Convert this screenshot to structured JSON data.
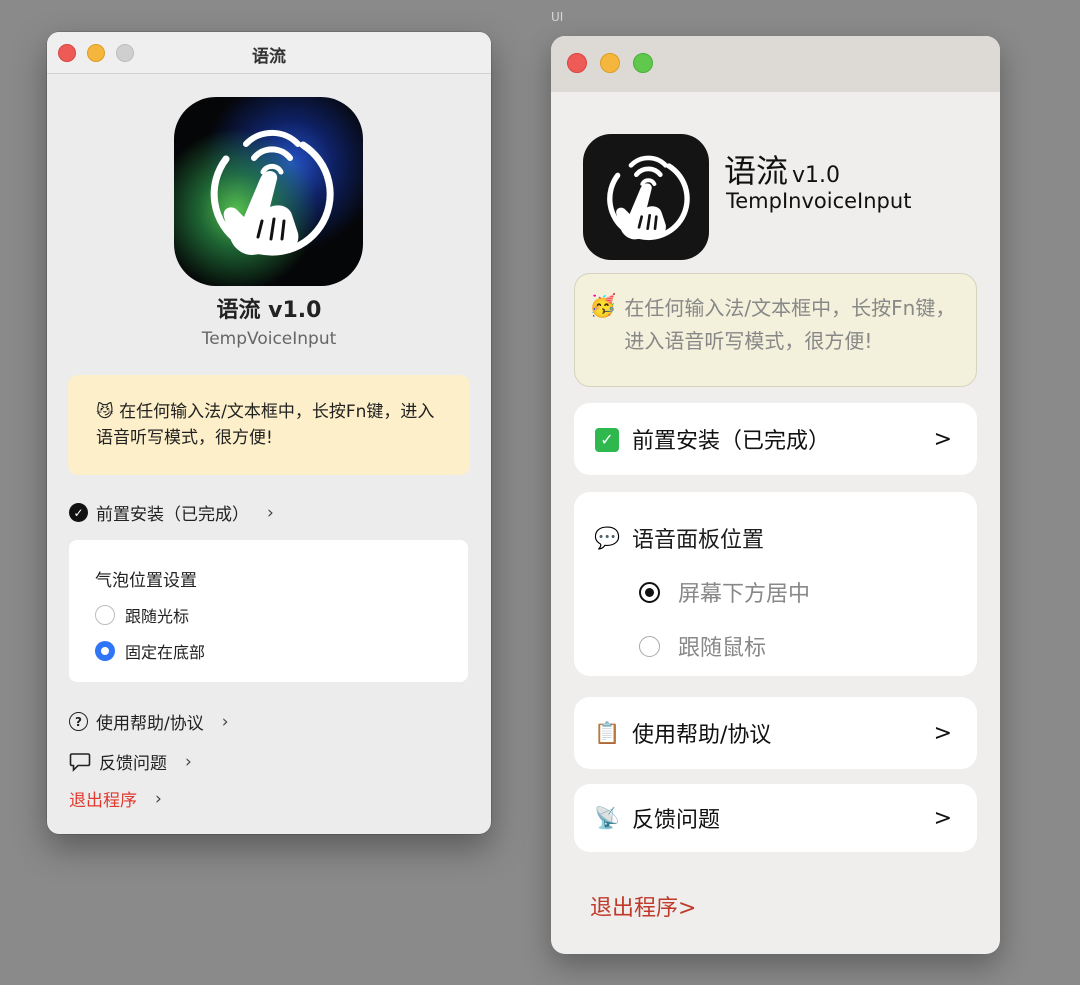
{
  "canvas": {
    "caption": "UI"
  },
  "left_window": {
    "title": "语流",
    "app_name": "语流 v1.0",
    "app_subtitle": "TempVoiceInput",
    "tip": {
      "emoji": "😼",
      "text": "在任何输入法/文本框中，长按Fn键，进入语音听写模式，很方便!"
    },
    "setup": {
      "label": "前置安装（已完成）",
      "chevron": "›"
    },
    "bubble_panel": {
      "title": "气泡位置设置",
      "options": [
        {
          "label": "跟随光标",
          "selected": false
        },
        {
          "label": "固定在底部",
          "selected": true
        }
      ]
    },
    "help": {
      "label": "使用帮助/协议",
      "chevron": "›"
    },
    "feedback": {
      "label": "反馈问题",
      "chevron": "›"
    },
    "quit": {
      "label": "退出程序",
      "chevron": "›"
    }
  },
  "right_window": {
    "app_name": "语流",
    "version": "v1.0",
    "app_subtitle": "TempInvoiceInput",
    "tip": {
      "emoji": "🥳",
      "text": "在任何输入法/文本框中，长按Fn键，进入语音听写模式，很方便!"
    },
    "setup": {
      "icon": "✓",
      "label": "前置安装（已完成）",
      "chevron": ">"
    },
    "voice_panel": {
      "icon": "💬",
      "title": "语音面板位置",
      "options": [
        {
          "label": "屏幕下方居中",
          "selected": true
        },
        {
          "label": "跟随鼠标",
          "selected": false
        }
      ]
    },
    "help": {
      "icon": "📋",
      "label": "使用帮助/协议",
      "chevron": ">"
    },
    "feedback": {
      "icon": "📡",
      "label": "反馈问题",
      "chevron": ">"
    },
    "quit": {
      "label": "退出程序>"
    }
  },
  "colors": {
    "left_tip_bg": "#fcefc9",
    "right_tip_bg": "#f3f1dc",
    "radio_accent": "#2f76f6",
    "quit_left": "#e03a2f",
    "quit_right": "#c0392b",
    "check_green": "#2eb84d"
  }
}
